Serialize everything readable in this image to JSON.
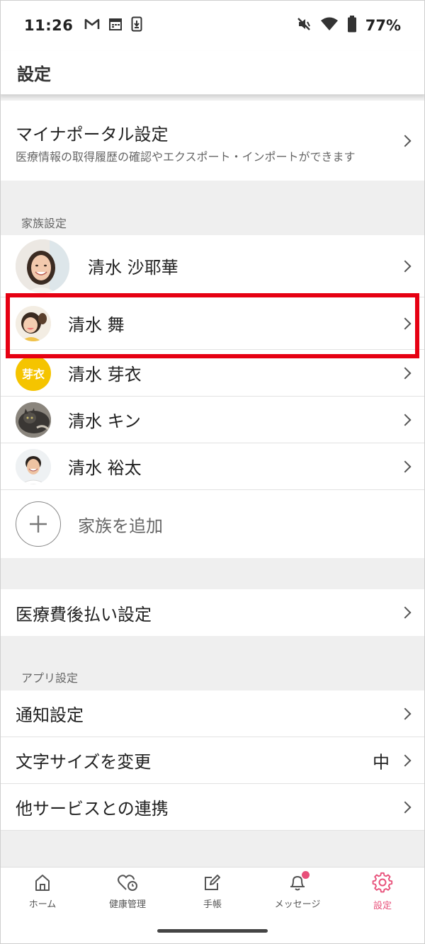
{
  "status_bar": {
    "time": "11:26",
    "left_icons": [
      "gmail-icon",
      "calendar-icon",
      "download-icon"
    ],
    "right_icons": [
      "vibrate-off-icon",
      "wifi-icon",
      "battery-icon"
    ],
    "battery": "77%"
  },
  "header": {
    "title": "設定"
  },
  "myna_portal": {
    "title": "マイナポータル設定",
    "subtitle": "医療情報の取得履歴の確認やエクスポート・インポートができます"
  },
  "family": {
    "section_label": "家族設定",
    "members": [
      {
        "name": "清水 沙耶華",
        "avatar": "photo-woman"
      },
      {
        "name": "清水 舞",
        "avatar": "photo-girl"
      },
      {
        "name": "清水 芽衣",
        "avatar": "text-badge",
        "avatar_text": "芽衣",
        "avatar_color": "#f5c400"
      },
      {
        "name": "清水 キン",
        "avatar": "photo-cat"
      },
      {
        "name": "清水 裕太",
        "avatar": "photo-man"
      }
    ],
    "add_label": "家族を追加"
  },
  "medical_payment": {
    "label": "医療費後払い設定"
  },
  "app_settings": {
    "section_label": "アプリ設定",
    "items": [
      {
        "label": "通知設定",
        "value": ""
      },
      {
        "label": "文字サイズを変更",
        "value": "中"
      },
      {
        "label": "他サービスとの連携",
        "value": ""
      }
    ]
  },
  "bottom_nav": {
    "items": [
      {
        "label": "ホーム",
        "icon": "home-icon"
      },
      {
        "label": "健康管理",
        "icon": "health-icon"
      },
      {
        "label": "手帳",
        "icon": "notebook-edit-icon"
      },
      {
        "label": "メッセージ",
        "icon": "bell-icon",
        "badge": true
      },
      {
        "label": "設定",
        "icon": "gear-icon",
        "active": true
      }
    ],
    "active_color": "#e8507a",
    "badge_color": "#e8507a"
  },
  "highlight_color": "#e60012"
}
